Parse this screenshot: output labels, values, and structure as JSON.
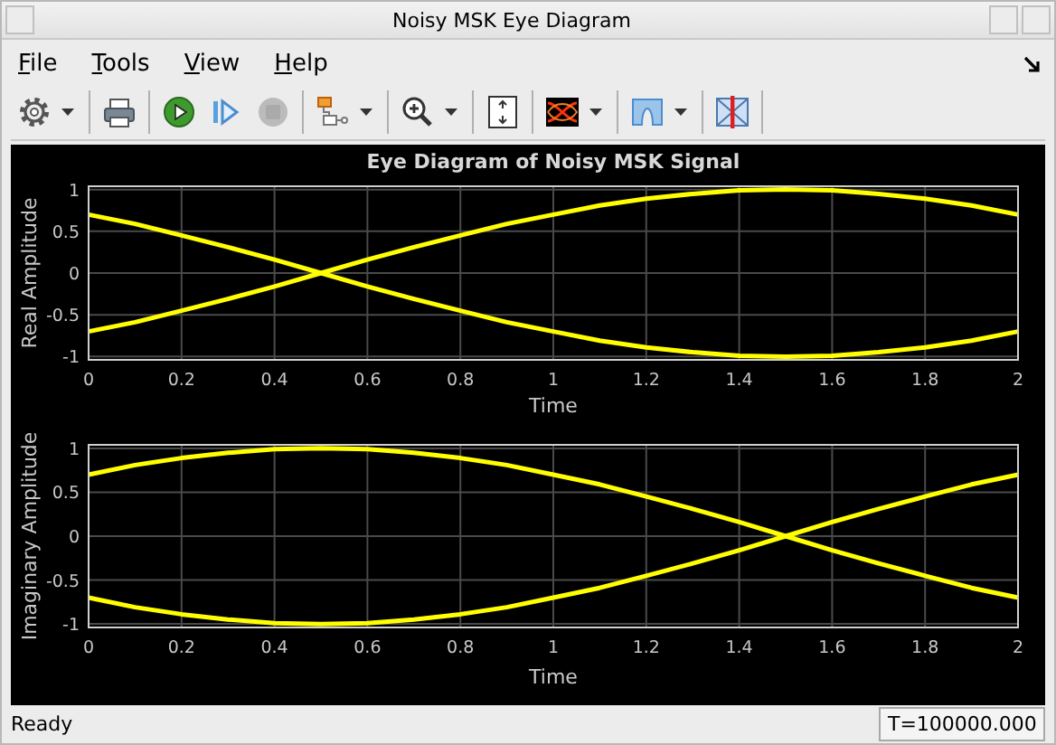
{
  "window": {
    "title": "Noisy MSK Eye Diagram"
  },
  "menu": [
    "File",
    "Tools",
    "View",
    "Help"
  ],
  "toolbar": [
    [
      {
        "kind": "settings",
        "disabled": false,
        "dropdown": true
      }
    ],
    [
      {
        "kind": "print",
        "disabled": false,
        "dropdown": false
      }
    ],
    [
      {
        "kind": "run",
        "disabled": false,
        "dropdown": false
      },
      {
        "kind": "step",
        "disabled": false,
        "dropdown": false
      },
      {
        "kind": "stop",
        "disabled": true,
        "dropdown": false
      }
    ],
    [
      {
        "kind": "blocks",
        "disabled": false,
        "dropdown": true
      }
    ],
    [
      {
        "kind": "zoom",
        "disabled": false,
        "dropdown": true
      }
    ],
    [
      {
        "kind": "autoscale",
        "disabled": false,
        "dropdown": false
      }
    ],
    [
      {
        "kind": "eye",
        "disabled": false,
        "dropdown": true
      }
    ],
    [
      {
        "kind": "bars",
        "disabled": false,
        "dropdown": true
      }
    ],
    [
      {
        "kind": "measure",
        "disabled": false,
        "dropdown": false
      }
    ]
  ],
  "plots": [
    {
      "chart_data": {
        "type": "line",
        "title": "Eye Diagram of Noisy MSK Signal",
        "xlabel": "Time",
        "ylabel": "Real Amplitude",
        "grid": true,
        "x": [
          0,
          0.1,
          0.2,
          0.3,
          0.4,
          0.5,
          0.6,
          0.7,
          0.8,
          0.9,
          1,
          1.1,
          1.2,
          1.3,
          1.4,
          1.5,
          1.6,
          1.7,
          1.8,
          1.9,
          2
        ],
        "xlim": [
          0,
          2
        ],
        "ylim": [
          -1.04,
          1.04
        ],
        "xticks": [
          0,
          0.2,
          0.4,
          0.6,
          0.8,
          1,
          1.2,
          1.4,
          1.6,
          1.8,
          2
        ],
        "yticks": [
          -1,
          -0.5,
          0,
          0.5,
          1
        ],
        "series": [
          {
            "color": "#ffff00",
            "values": [
              0.7,
              0.59,
              0.45,
              0.31,
              0.16,
              0,
              -0.16,
              -0.31,
              -0.45,
              -0.59,
              -0.7,
              -0.81,
              -0.89,
              -0.95,
              -0.99,
              -1,
              -0.99,
              -0.95,
              -0.89,
              -0.81,
              -0.7
            ]
          },
          {
            "color": "#ffff00",
            "values": [
              -0.7,
              -0.59,
              -0.45,
              -0.31,
              -0.16,
              0,
              0.16,
              0.31,
              0.45,
              0.59,
              0.7,
              0.81,
              0.89,
              0.95,
              0.99,
              1,
              0.99,
              0.95,
              0.89,
              0.81,
              0.7
            ]
          }
        ]
      }
    },
    {
      "chart_data": {
        "type": "line",
        "xlabel": "Time",
        "ylabel": "Imaginary Amplitude",
        "grid": true,
        "x": [
          0,
          0.1,
          0.2,
          0.3,
          0.4,
          0.5,
          0.6,
          0.7,
          0.8,
          0.9,
          1,
          1.1,
          1.2,
          1.3,
          1.4,
          1.5,
          1.6,
          1.7,
          1.8,
          1.9,
          2
        ],
        "xlim": [
          0,
          2
        ],
        "ylim": [
          -1.04,
          1.04
        ],
        "xticks": [
          0,
          0.2,
          0.4,
          0.6,
          0.8,
          1,
          1.2,
          1.4,
          1.6,
          1.8,
          2
        ],
        "yticks": [
          -1,
          -0.5,
          0,
          0.5,
          1
        ],
        "series": [
          {
            "color": "#ffff00",
            "values": [
              0.7,
              0.81,
              0.89,
              0.95,
              0.99,
              1,
              0.99,
              0.95,
              0.89,
              0.81,
              0.7,
              0.59,
              0.45,
              0.31,
              0.16,
              0,
              -0.16,
              -0.31,
              -0.45,
              -0.59,
              -0.7
            ]
          },
          {
            "color": "#ffff00",
            "values": [
              -0.7,
              -0.81,
              -0.89,
              -0.95,
              -0.99,
              -1,
              -0.99,
              -0.95,
              -0.89,
              -0.81,
              -0.7,
              -0.59,
              -0.45,
              -0.31,
              -0.16,
              0,
              0.16,
              0.31,
              0.45,
              0.59,
              0.7
            ]
          }
        ]
      }
    }
  ],
  "status": {
    "message": "Ready",
    "time": "T=100000.000"
  }
}
